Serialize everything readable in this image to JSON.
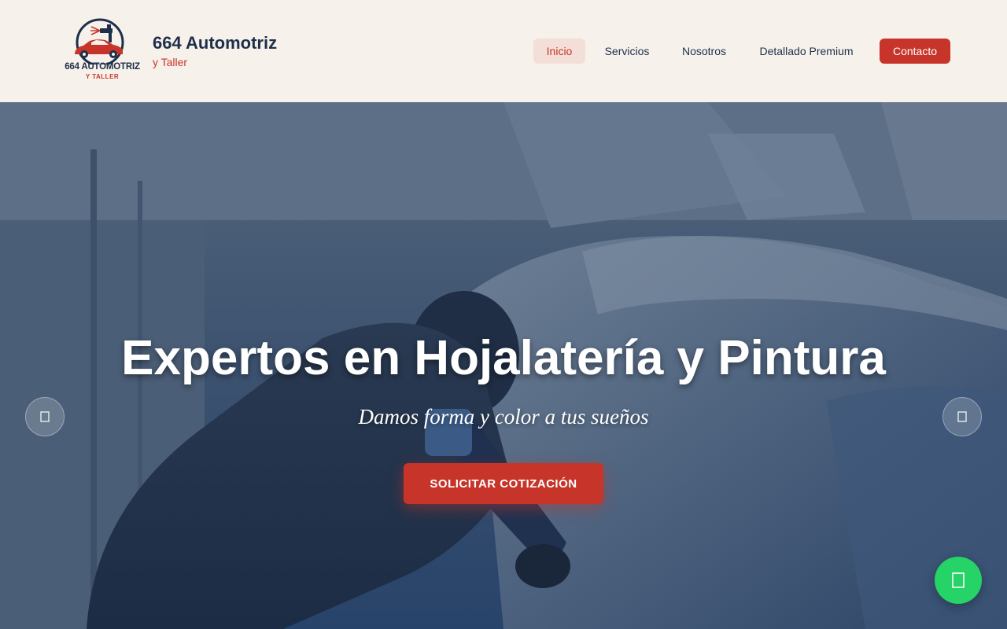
{
  "header": {
    "logo": {
      "main_text": "664 AUTOMOTRIZ",
      "sub_text": "Y TALLER",
      "icon": "spray-gun-car-icon"
    },
    "brand_title": "664 Automotriz",
    "brand_subtitle": "y Taller",
    "nav": {
      "inicio": "Inicio",
      "servicios": "Servicios",
      "nosotros": "Nosotros",
      "detallado": "Detallado Premium",
      "contacto": "Contacto"
    },
    "colors": {
      "accent": "#c7352a",
      "navy": "#1e2f4a",
      "background": "#f7f1eb"
    }
  },
  "hero": {
    "title": "Expertos en Hojalatería y Pintura",
    "subtitle": "Damos forma y color a tus sueños",
    "cta_label": "SOLICITAR COTIZACIÓN",
    "prev_icon": "chevron-left-icon",
    "next_icon": "chevron-right-icon"
  },
  "floating": {
    "whatsapp_icon": "whatsapp-icon",
    "whatsapp_color": "#25d366"
  }
}
